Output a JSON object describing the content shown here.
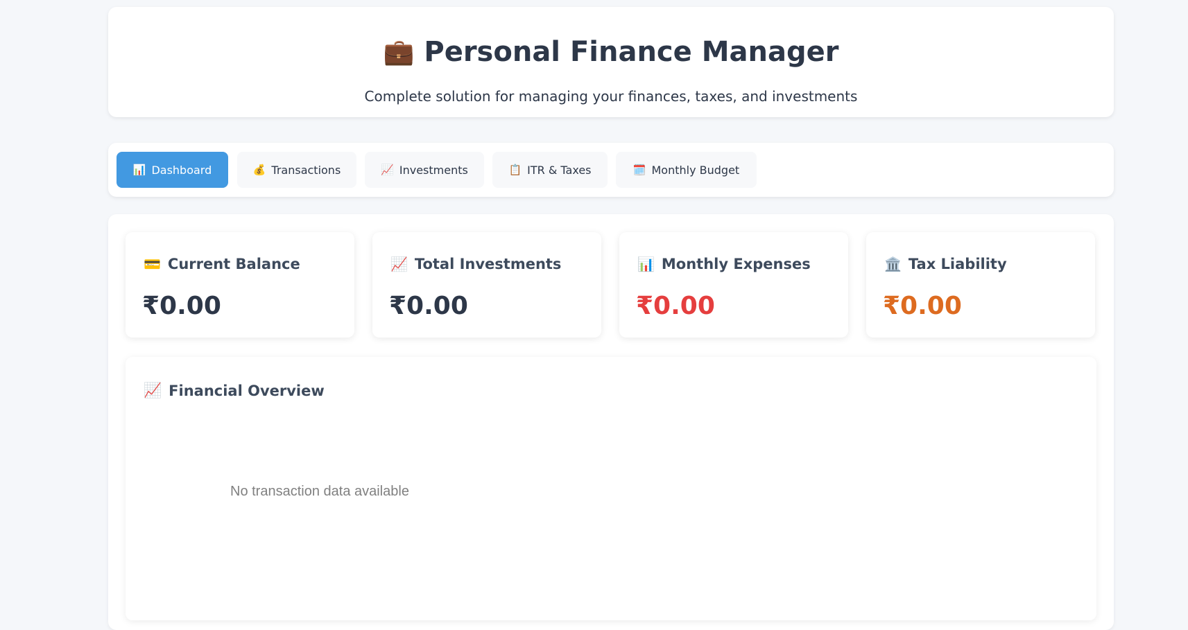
{
  "header": {
    "icon": "💼",
    "icon_name": "briefcase-icon",
    "title": "Personal Finance Manager",
    "subtitle": "Complete solution for managing your finances, taxes, and investments"
  },
  "tabs": [
    {
      "icon": "📊",
      "icon_name": "bar-chart-icon",
      "label": "Dashboard",
      "active": true
    },
    {
      "icon": "💰",
      "icon_name": "money-bag-icon",
      "label": "Transactions",
      "active": false
    },
    {
      "icon": "📈",
      "icon_name": "trending-up-icon",
      "label": "Investments",
      "active": false
    },
    {
      "icon": "📋",
      "icon_name": "clipboard-icon",
      "label": "ITR & Taxes",
      "active": false
    },
    {
      "icon": "🗓️",
      "icon_name": "calendar-icon",
      "label": "Monthly Budget",
      "active": false
    }
  ],
  "cards": [
    {
      "icon": "💳",
      "icon_name": "credit-card-icon",
      "title": "Current Balance",
      "value": "₹0.00",
      "color": "#2d3748"
    },
    {
      "icon": "📈",
      "icon_name": "trending-up-icon",
      "title": "Total Investments",
      "value": "₹0.00",
      "color": "#2d3748"
    },
    {
      "icon": "📊",
      "icon_name": "bar-chart-icon",
      "title": "Monthly Expenses",
      "value": "₹0.00",
      "color": "#e53e3e"
    },
    {
      "icon": "🏛️",
      "icon_name": "bank-icon",
      "title": "Tax Liability",
      "value": "₹0.00",
      "color": "#dd6b20"
    }
  ],
  "overview": {
    "icon": "📈",
    "icon_name": "trending-up-icon",
    "title": "Financial Overview",
    "empty_message": "No transaction data available"
  },
  "colors": {
    "accent": "#4299e1",
    "background": "#f5f7fa",
    "expense": "#e53e3e",
    "tax": "#dd6b20"
  }
}
